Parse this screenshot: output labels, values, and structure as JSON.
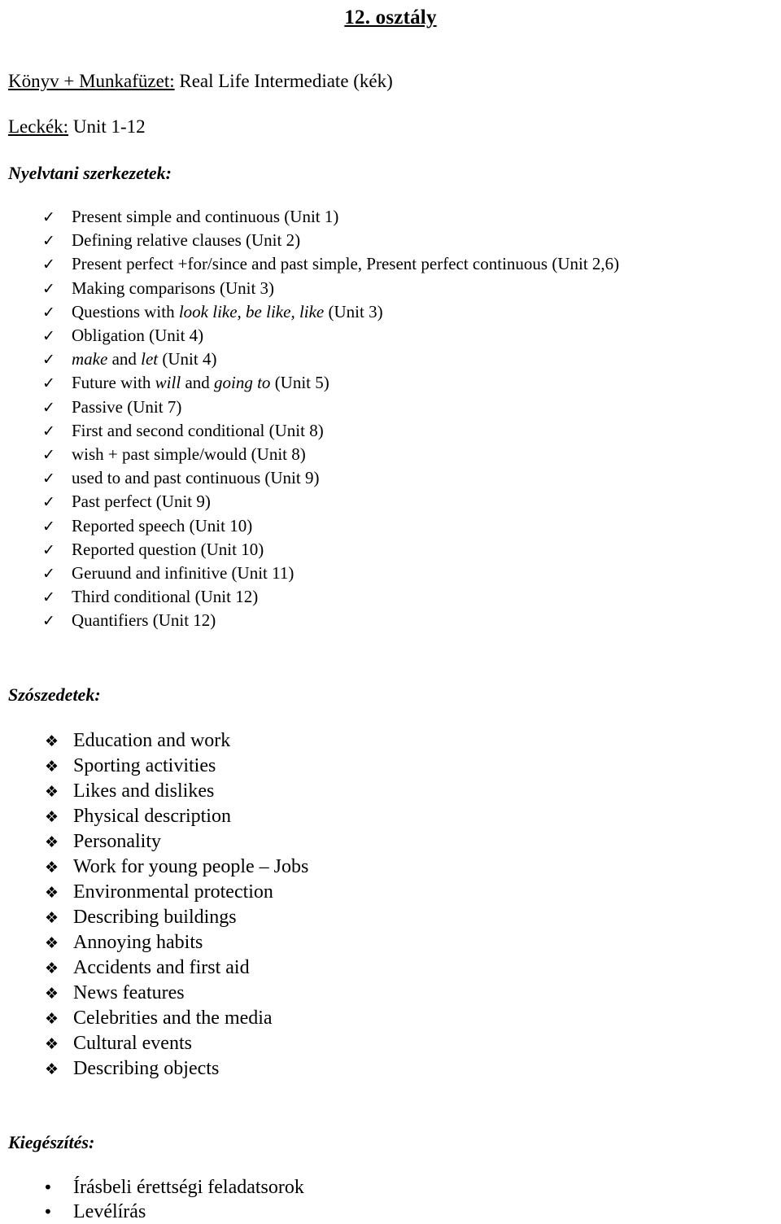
{
  "document": {
    "title": "12. osztály"
  },
  "meta": {
    "book": {
      "label": "Könyv + Munkafüzet:",
      "value": " Real Life Intermediate (kék)"
    },
    "lessons": {
      "label": "Leckék:",
      "value": " Unit 1-12"
    }
  },
  "sections": {
    "grammar": {
      "heading": "Nyelvtani szerkezetek:",
      "bullet_icon": "check-mark",
      "bullet_glyph": "✓",
      "items": [
        {
          "parts": [
            {
              "text": "Present simple and continuous (Unit 1)",
              "italic": false
            }
          ]
        },
        {
          "parts": [
            {
              "text": "Defining relative clauses (Unit 2)",
              "italic": false
            }
          ]
        },
        {
          "parts": [
            {
              "text": "Present perfect +for/since and past simple, Present perfect continuous (Unit 2,6)",
              "italic": false
            }
          ]
        },
        {
          "parts": [
            {
              "text": "Making comparisons (Unit 3)",
              "italic": false
            }
          ]
        },
        {
          "parts": [
            {
              "text": "Questions with ",
              "italic": false
            },
            {
              "text": "look like, be like, like",
              "italic": true
            },
            {
              "text": " (Unit 3)",
              "italic": false
            }
          ]
        },
        {
          "parts": [
            {
              "text": "Obligation (Unit 4)",
              "italic": false
            }
          ]
        },
        {
          "parts": [
            {
              "text": "make",
              "italic": true
            },
            {
              "text": " and ",
              "italic": false
            },
            {
              "text": "let",
              "italic": true
            },
            {
              "text": " (Unit 4)",
              "italic": false
            }
          ]
        },
        {
          "parts": [
            {
              "text": "Future with ",
              "italic": false
            },
            {
              "text": "will",
              "italic": true
            },
            {
              "text": " and ",
              "italic": false
            },
            {
              "text": "going to",
              "italic": true
            },
            {
              "text": " (Unit 5)",
              "italic": false
            }
          ]
        },
        {
          "parts": [
            {
              "text": "Passive (Unit 7)",
              "italic": false
            }
          ]
        },
        {
          "parts": [
            {
              "text": "First and second conditional (Unit 8)",
              "italic": false
            }
          ]
        },
        {
          "parts": [
            {
              "text": "wish + past simple/would (Unit 8)",
              "italic": false
            }
          ]
        },
        {
          "parts": [
            {
              "text": "used to and past continuous (Unit 9)",
              "italic": false
            }
          ]
        },
        {
          "parts": [
            {
              "text": "Past perfect (Unit 9)",
              "italic": false
            }
          ]
        },
        {
          "parts": [
            {
              "text": "Reported speech (Unit 10)",
              "italic": false
            }
          ]
        },
        {
          "parts": [
            {
              "text": "Reported question (Unit 10)",
              "italic": false
            }
          ]
        },
        {
          "parts": [
            {
              "text": "Geruund and infinitive (Unit 11)",
              "italic": false
            }
          ]
        },
        {
          "parts": [
            {
              "text": "Third conditional (Unit 12)",
              "italic": false
            }
          ]
        },
        {
          "parts": [
            {
              "text": "Quantifiers (Unit 12)",
              "italic": false
            }
          ]
        }
      ]
    },
    "vocabulary": {
      "heading": "Szószedetek:",
      "bullet_icon": "floral-diamond",
      "bullet_glyph": "❖",
      "items": [
        {
          "parts": [
            {
              "text": "Education and work",
              "italic": false
            }
          ]
        },
        {
          "parts": [
            {
              "text": "Sporting activities",
              "italic": false
            }
          ]
        },
        {
          "parts": [
            {
              "text": "Likes and dislikes",
              "italic": false
            }
          ]
        },
        {
          "parts": [
            {
              "text": "Physical description",
              "italic": false
            }
          ]
        },
        {
          "parts": [
            {
              "text": "Personality",
              "italic": false
            }
          ]
        },
        {
          "parts": [
            {
              "text": "Work for young people – Jobs",
              "italic": false
            }
          ]
        },
        {
          "parts": [
            {
              "text": "Environmental protection",
              "italic": false
            }
          ]
        },
        {
          "parts": [
            {
              "text": "Describing buildings",
              "italic": false
            }
          ]
        },
        {
          "parts": [
            {
              "text": "Annoying habits",
              "italic": false
            }
          ]
        },
        {
          "parts": [
            {
              "text": "Accidents and first aid",
              "italic": false
            }
          ]
        },
        {
          "parts": [
            {
              "text": "News features",
              "italic": false
            }
          ]
        },
        {
          "parts": [
            {
              "text": "Celebrities and the media",
              "italic": false
            }
          ]
        },
        {
          "parts": [
            {
              "text": "Cultural events",
              "italic": false
            }
          ]
        },
        {
          "parts": [
            {
              "text": "Describing objects",
              "italic": false
            }
          ]
        }
      ]
    },
    "extra": {
      "heading": "Kiegészítés:",
      "bullet_icon": "round-bullet",
      "bullet_glyph": "•",
      "items": [
        {
          "parts": [
            {
              "text": "Írásbeli érettségi feladatsorok",
              "italic": false
            }
          ]
        },
        {
          "parts": [
            {
              "text": "Levélírás",
              "italic": false
            }
          ]
        }
      ]
    }
  }
}
